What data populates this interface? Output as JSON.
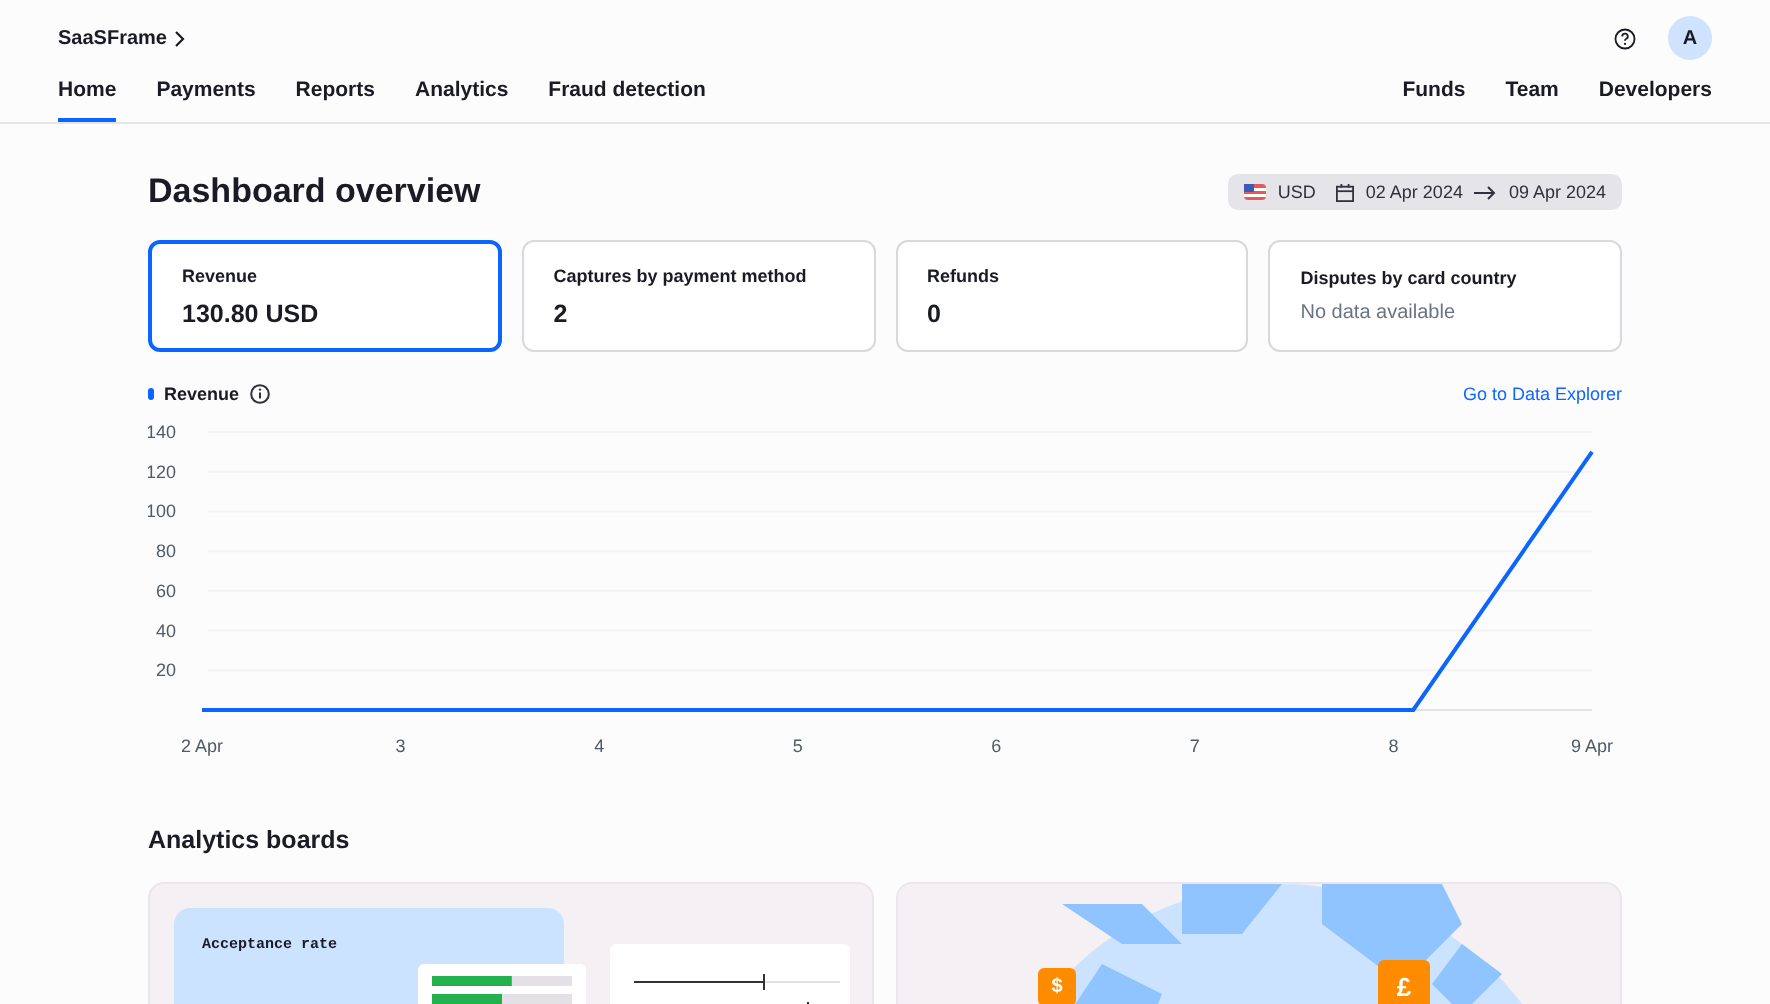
{
  "header": {
    "brand": "SaaSFrame",
    "avatar": "A"
  },
  "nav_left": [
    {
      "label": "Home",
      "selected": true
    },
    {
      "label": "Payments",
      "selected": false
    },
    {
      "label": "Reports",
      "selected": false
    },
    {
      "label": "Analytics",
      "selected": false
    },
    {
      "label": "Fraud detection",
      "selected": false
    }
  ],
  "nav_right": [
    {
      "label": "Funds",
      "selected": false
    },
    {
      "label": "Team",
      "selected": false
    },
    {
      "label": "Developers",
      "selected": false
    }
  ],
  "title": "Dashboard overview",
  "filter": {
    "currency": "USD",
    "start": "02 Apr 2024",
    "end": "09 Apr 2024"
  },
  "metrics": [
    {
      "label": "Revenue",
      "value": "130.80 USD",
      "selected": true,
      "empty": false
    },
    {
      "label": "Captures by payment method",
      "value": "2",
      "selected": false,
      "empty": false
    },
    {
      "label": "Refunds",
      "value": "0",
      "selected": false,
      "empty": false
    },
    {
      "label": "Disputes by card country",
      "value": "No data available",
      "selected": false,
      "empty": true
    }
  ],
  "chart": {
    "link": "Go to Data Explorer",
    "chart_data": {
      "type": "line",
      "grid": true,
      "x": [
        2,
        8.1,
        9
      ],
      "series": [
        {
          "name": "Revenue",
          "color": "#0a66ff",
          "values": [
            0,
            0,
            130
          ]
        }
      ],
      "xlim": [
        2,
        9
      ],
      "ylim": [
        0,
        140
      ],
      "xticks": [
        {
          "value": 2,
          "label": "2 Apr"
        },
        3,
        4,
        5,
        6,
        7,
        8,
        {
          "value": 9,
          "label": "9 Apr"
        }
      ],
      "yticks": [
        20,
        40,
        60,
        80,
        100,
        120,
        140
      ]
    }
  },
  "boards_title": "Analytics boards",
  "boards": [
    {
      "kind": "acceptance",
      "caption": "Acceptance rate",
      "bars": [
        {
          "level": 0.57
        },
        {
          "level": 0.5
        }
      ]
    },
    {
      "kind": "map",
      "marks": [
        "$",
        "£"
      ]
    }
  ]
}
